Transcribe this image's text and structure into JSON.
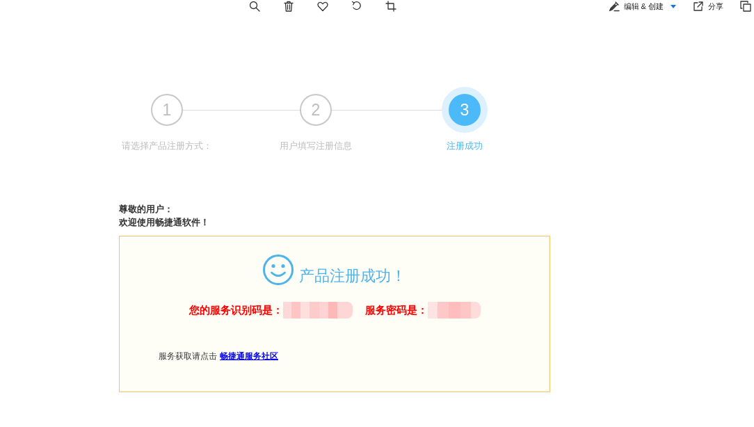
{
  "toolbar": {
    "actions": [
      {
        "label": "编辑 & 创建",
        "kind": "dropdown"
      },
      {
        "label": "分享",
        "kind": "plain"
      }
    ]
  },
  "steps": [
    {
      "number": "1",
      "label": "请选择产品注册方式：",
      "active": false
    },
    {
      "number": "2",
      "label": "用户填写注册信息",
      "active": false
    },
    {
      "number": "3",
      "label": "注册成功",
      "active": true
    }
  ],
  "greeting": {
    "salutation": "尊敬的用户：",
    "welcome": "欢迎使用畅捷通软件！"
  },
  "result_panel": {
    "title": "产品注册成功！",
    "credentials": [
      {
        "label": "您的服务识别码是："
      },
      {
        "label": "服务密码是："
      }
    ],
    "service_note": "服务获取请点击",
    "service_link": "畅捷通服务社区"
  }
}
